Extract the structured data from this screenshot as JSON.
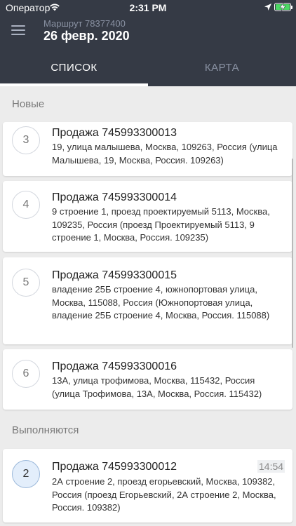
{
  "status_bar": {
    "carrier": "Оператор",
    "time": "2:31 PM",
    "icons": [
      "wifi-icon",
      "location-arrow-icon",
      "battery-charging-icon"
    ]
  },
  "header": {
    "route_label": "Маршрут 78377400",
    "date": "26 февр. 2020",
    "menu_icon": "hamburger-menu-icon",
    "background_color": "#353a45"
  },
  "tabs": [
    {
      "label": "СПИСОК",
      "active": true
    },
    {
      "label": "КАРТА",
      "active": false
    }
  ],
  "sections": [
    {
      "title": "Новые",
      "items": [
        {
          "number": "3",
          "title": "Продажа 745993300013",
          "address": "19, улица малышева, Москва, 109263, Россия (улица Малышева, 19, Москва, Россия. 109263)"
        },
        {
          "number": "4",
          "title": "Продажа 745993300014",
          "address": "9 строение 1, проезд проектируемый 5113, Москва, 109235, Россия (проезд Проектируемый 5113, 9 строение 1, Москва, Россия. 109235)"
        },
        {
          "number": "5",
          "title": "Продажа 745993300015",
          "address": "владение 25Б строение 4, южнопортовая улица, Москва, 115088, Россия (Южнопортовая улица, владение 25Б строение 4, Москва, Россия. 115088)"
        },
        {
          "number": "6",
          "title": "Продажа 745993300016",
          "address": "13А, улица трофимова, Москва, 115432, Россия (улица Трофимова, 13А, Москва, Россия. 115432)"
        }
      ]
    },
    {
      "title": "Выполняются",
      "items": [
        {
          "number": "2",
          "title": "Продажа 745993300012",
          "address": "2А строение 2, проезд егорьевский, Москва, 109382, Россия (проезд Егорьевский, 2А строение 2, Москва, Россия. 109382)",
          "time": "14:54"
        }
      ]
    }
  ]
}
